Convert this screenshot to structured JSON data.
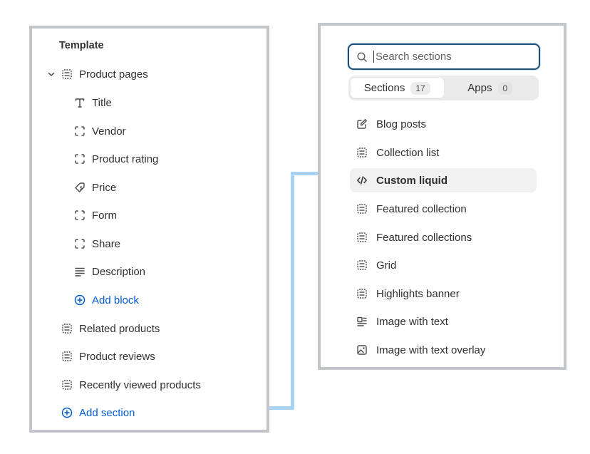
{
  "template_panel": {
    "heading": "Template",
    "group": {
      "label": "Product pages",
      "icon": "section-icon",
      "expanded": true
    },
    "blocks": [
      {
        "label": "Title",
        "icon": "text-icon"
      },
      {
        "label": "Vendor",
        "icon": "block-icon"
      },
      {
        "label": "Product rating",
        "icon": "block-icon"
      },
      {
        "label": "Price",
        "icon": "price-tag-icon"
      },
      {
        "label": "Form",
        "icon": "block-icon"
      },
      {
        "label": "Share",
        "icon": "block-icon"
      },
      {
        "label": "Description",
        "icon": "paragraph-icon"
      }
    ],
    "add_block": "Add block",
    "sections": [
      {
        "label": "Related products",
        "icon": "section-icon"
      },
      {
        "label": "Product reviews",
        "icon": "section-icon"
      },
      {
        "label": "Recently viewed products",
        "icon": "section-icon"
      }
    ],
    "add_section": "Add section"
  },
  "picker": {
    "search_placeholder": "Search sections",
    "tabs": [
      {
        "label": "Sections",
        "count": "17",
        "active": true
      },
      {
        "label": "Apps",
        "count": "0",
        "active": false
      }
    ],
    "items": [
      {
        "label": "Blog posts",
        "icon": "edit-icon"
      },
      {
        "label": "Collection list",
        "icon": "section-icon"
      },
      {
        "label": "Custom liquid",
        "icon": "code-icon",
        "selected": true
      },
      {
        "label": "Featured collection",
        "icon": "section-icon"
      },
      {
        "label": "Featured collections",
        "icon": "section-icon"
      },
      {
        "label": "Grid",
        "icon": "section-icon"
      },
      {
        "label": "Highlights banner",
        "icon": "section-icon"
      },
      {
        "label": "Image with text",
        "icon": "image-with-text-icon"
      },
      {
        "label": "Image with text overlay",
        "icon": "image-overlay-icon"
      }
    ]
  },
  "colors": {
    "accent": "#005bd3",
    "panel_border": "#c2c5c9",
    "connector": "#a9d3f5",
    "text": "#303030"
  }
}
